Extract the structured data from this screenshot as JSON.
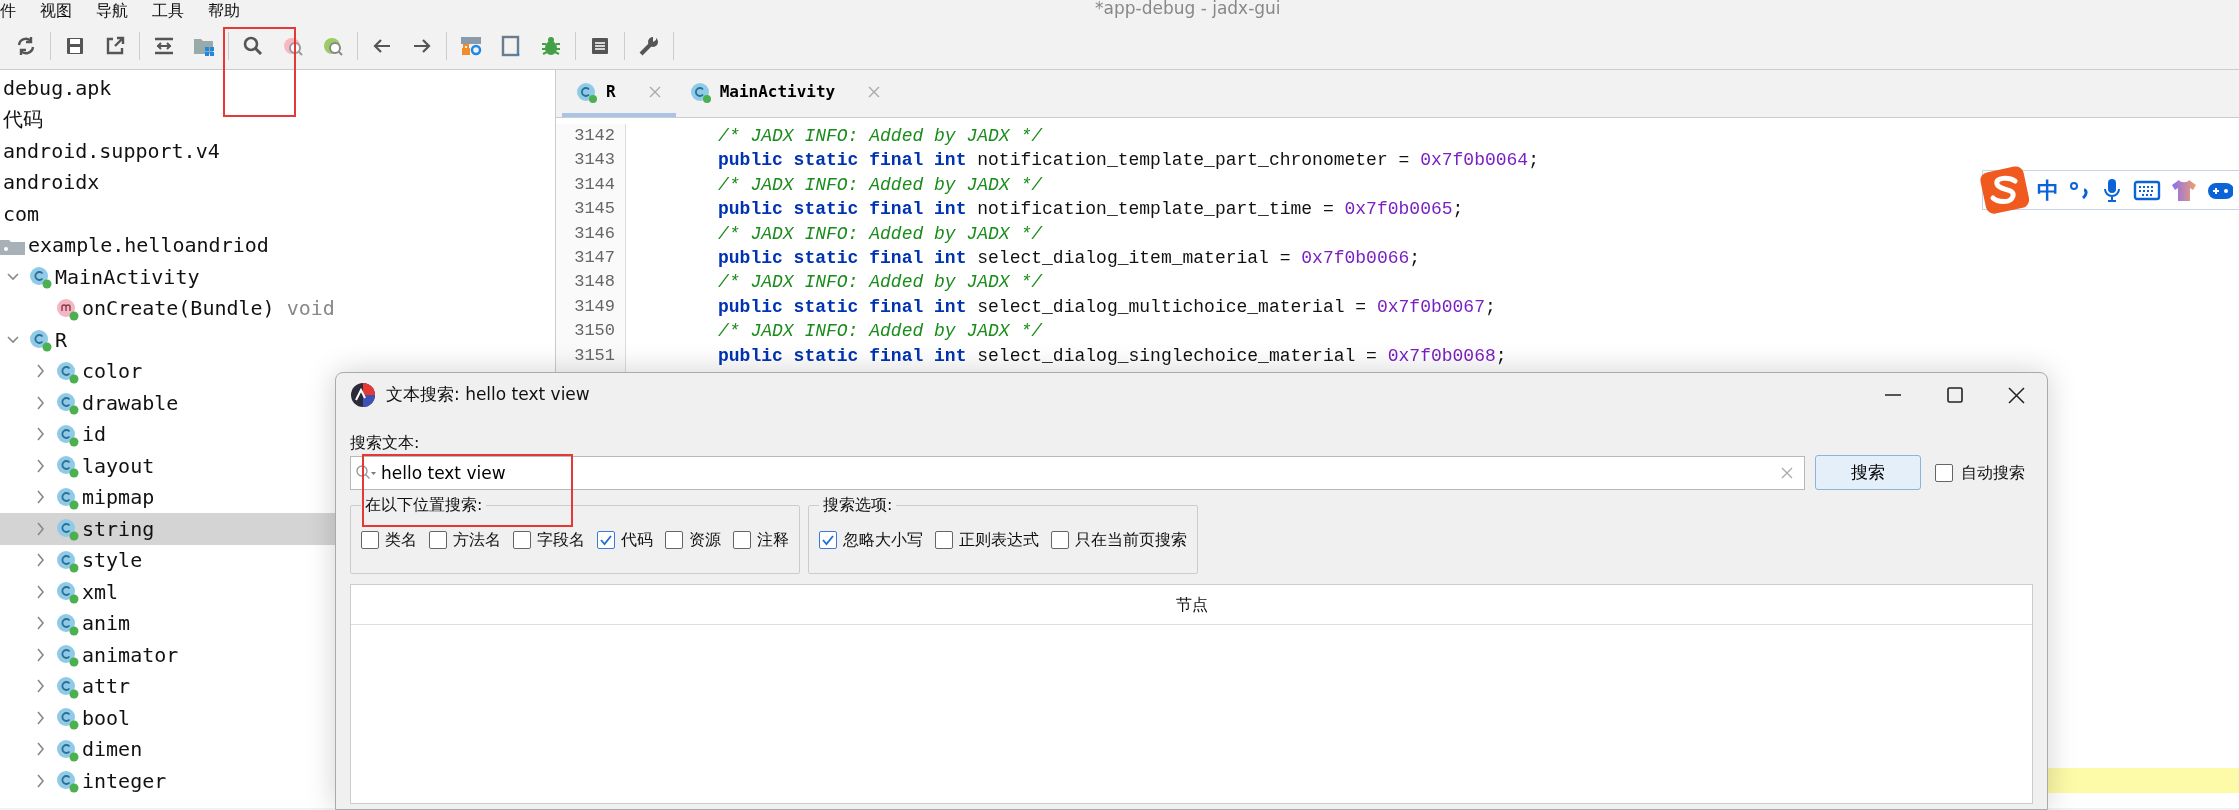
{
  "window": {
    "title": "*app-debug - jadx-gui"
  },
  "menu": [
    {
      "label": "件"
    },
    {
      "label": "视图"
    },
    {
      "label": "导航"
    },
    {
      "label": "工具"
    },
    {
      "label": "帮助"
    }
  ],
  "tree": [
    {
      "label": "debug.apk",
      "kind": "plain",
      "selected": false
    },
    {
      "label": "代码",
      "kind": "plain",
      "selected": false
    },
    {
      "label": "android.support.v4",
      "kind": "plain",
      "selected": false
    },
    {
      "label": "androidx",
      "kind": "plain",
      "selected": false
    },
    {
      "label": "com",
      "kind": "plain",
      "selected": false
    },
    {
      "label": "example.helloandriod",
      "kind": "package",
      "selected": false,
      "children": [
        {
          "label": "MainActivity",
          "kind": "class",
          "expanded": true,
          "selected": false,
          "children": [
            {
              "label": "onCreate(Bundle)",
              "return_type": "void",
              "kind": "method",
              "selected": false
            }
          ]
        },
        {
          "label": "R",
          "kind": "class",
          "expanded": true,
          "selected": false,
          "children": [
            {
              "label": "color",
              "kind": "class",
              "expanded": false,
              "selected": false
            },
            {
              "label": "drawable",
              "kind": "class",
              "expanded": false,
              "selected": false
            },
            {
              "label": "id",
              "kind": "class",
              "expanded": false,
              "selected": false
            },
            {
              "label": "layout",
              "kind": "class",
              "expanded": false,
              "selected": false
            },
            {
              "label": "mipmap",
              "kind": "class",
              "expanded": false,
              "selected": false
            },
            {
              "label": "string",
              "kind": "class",
              "expanded": false,
              "selected": true
            },
            {
              "label": "style",
              "kind": "class",
              "expanded": false,
              "selected": false
            },
            {
              "label": "xml",
              "kind": "class",
              "expanded": false,
              "selected": false
            },
            {
              "label": "anim",
              "kind": "class",
              "expanded": false,
              "selected": false
            },
            {
              "label": "animator",
              "kind": "class",
              "expanded": false,
              "selected": false
            },
            {
              "label": "attr",
              "kind": "class",
              "expanded": false,
              "selected": false
            },
            {
              "label": "bool",
              "kind": "class",
              "expanded": false,
              "selected": false
            },
            {
              "label": "dimen",
              "kind": "class",
              "expanded": false,
              "selected": false
            },
            {
              "label": "integer",
              "kind": "class",
              "expanded": false,
              "selected": false
            }
          ]
        }
      ]
    }
  ],
  "tabs": [
    {
      "label": "R",
      "selected": true
    },
    {
      "label": "MainActivity",
      "selected": false
    }
  ],
  "code_lines": [
    {
      "number": "3142",
      "tokens": [
        {
          "text": "/* JADX INFO: Added by JADX */",
          "kind": "comment"
        }
      ]
    },
    {
      "number": "3143",
      "tokens": [
        {
          "text": "public static final int",
          "kind": "keyword"
        },
        {
          "text": " notification_template_part_chronometer = ",
          "kind": "plain"
        },
        {
          "text": "0x7f0b0064",
          "kind": "number"
        },
        {
          "text": ";",
          "kind": "plain"
        }
      ]
    },
    {
      "number": "3144",
      "tokens": [
        {
          "text": "/* JADX INFO: Added by JADX */",
          "kind": "comment"
        }
      ]
    },
    {
      "number": "3145",
      "tokens": [
        {
          "text": "public static final int",
          "kind": "keyword"
        },
        {
          "text": " notification_template_part_time = ",
          "kind": "plain"
        },
        {
          "text": "0x7f0b0065",
          "kind": "number"
        },
        {
          "text": ";",
          "kind": "plain"
        }
      ]
    },
    {
      "number": "3146",
      "tokens": [
        {
          "text": "/* JADX INFO: Added by JADX */",
          "kind": "comment"
        }
      ]
    },
    {
      "number": "3147",
      "tokens": [
        {
          "text": "public static final int",
          "kind": "keyword"
        },
        {
          "text": " select_dialog_item_material = ",
          "kind": "plain"
        },
        {
          "text": "0x7f0b0066",
          "kind": "number"
        },
        {
          "text": ";",
          "kind": "plain"
        }
      ]
    },
    {
      "number": "3148",
      "tokens": [
        {
          "text": "/* JADX INFO: Added by JADX */",
          "kind": "comment"
        }
      ]
    },
    {
      "number": "3149",
      "tokens": [
        {
          "text": "public static final int",
          "kind": "keyword"
        },
        {
          "text": " select_dialog_multichoice_material = ",
          "kind": "plain"
        },
        {
          "text": "0x7f0b0067",
          "kind": "number"
        },
        {
          "text": ";",
          "kind": "plain"
        }
      ]
    },
    {
      "number": "3150",
      "tokens": [
        {
          "text": "/* JADX INFO: Added by JADX */",
          "kind": "comment"
        }
      ]
    },
    {
      "number": "3151",
      "tokens": [
        {
          "text": "public static final int",
          "kind": "keyword"
        },
        {
          "text": " select_dialog_singlechoice_material = ",
          "kind": "plain"
        },
        {
          "text": "0x7f0b0068",
          "kind": "number"
        },
        {
          "text": ";",
          "kind": "plain"
        }
      ]
    }
  ],
  "ime_bar": {
    "mode": "中"
  },
  "dialog": {
    "title": "文本搜索: hello text view",
    "search_label": "搜索文本:",
    "search_value": "hello text view",
    "search_button": "搜索",
    "auto_search": {
      "label": "自动搜索",
      "checked": false
    },
    "groups": [
      {
        "title": "在以下位置搜索:",
        "options": [
          {
            "label": "类名",
            "checked": false
          },
          {
            "label": "方法名",
            "checked": false
          },
          {
            "label": "字段名",
            "checked": false
          },
          {
            "label": "代码",
            "checked": true
          },
          {
            "label": "资源",
            "checked": false
          },
          {
            "label": "注释",
            "checked": false
          }
        ]
      },
      {
        "title": "搜索选项:",
        "options": [
          {
            "label": "忽略大小写",
            "checked": true
          },
          {
            "label": "正则表达式",
            "checked": false
          },
          {
            "label": "只在当前页搜索",
            "checked": false
          }
        ]
      }
    ],
    "results_columns": [
      {
        "label": "节点"
      }
    ]
  }
}
